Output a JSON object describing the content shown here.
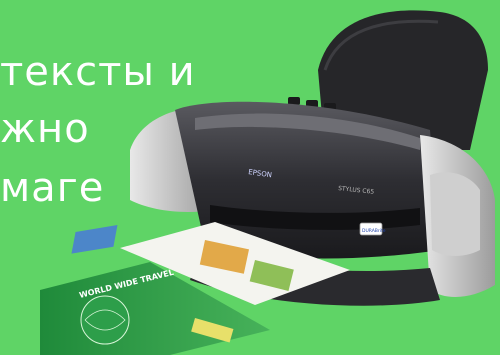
{
  "background_color": "#5fd466",
  "caption": {
    "lines": [
      "тексты и",
      "жно",
      "маге"
    ],
    "color": "#ffffff"
  },
  "printer": {
    "brand_label": "EPSON",
    "model_label": "STYLUS C65",
    "badge_label": "DURABrite",
    "body_color": "#2f2f33",
    "panel_color": "#d6d6d6"
  },
  "printed_sheet": {
    "headline": "WORLD WIDE TRAVEL"
  }
}
